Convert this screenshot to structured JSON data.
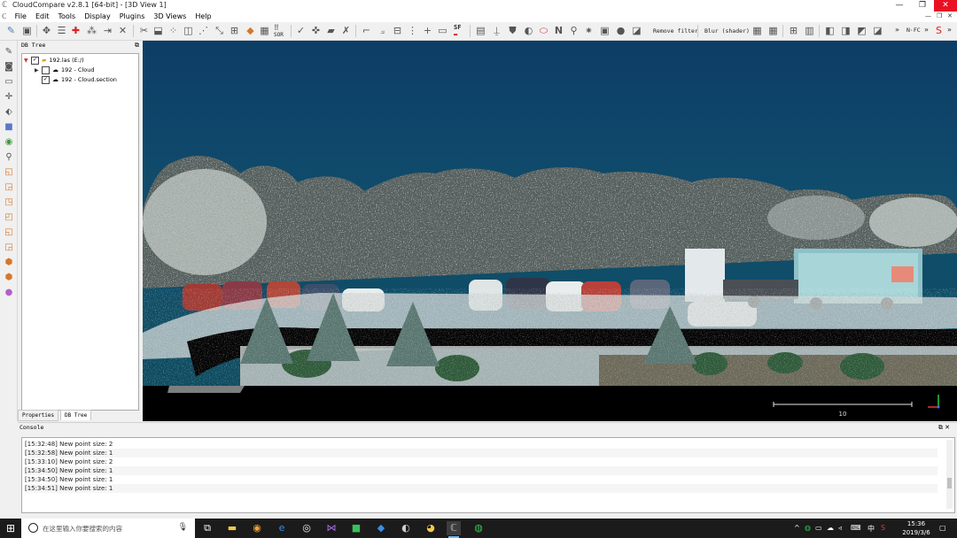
{
  "window": {
    "title": "CloudCompare v2.8.1 [64-bit] - [3D View 1]",
    "app_icon": "cloudcompare-icon",
    "minimize": "—",
    "maximize": "❐",
    "close": "✕"
  },
  "menubar": {
    "items": [
      "File",
      "Edit",
      "Tools",
      "Display",
      "Plugins",
      "3D Views",
      "Help"
    ],
    "mdi_controls": [
      "—",
      "❐",
      "✕"
    ]
  },
  "toolbar": {
    "remove_filter": "Remove filter",
    "blur_shader": "Blur (shader)",
    "sor_label": "SOR",
    "sf_label": "SF",
    "more1": "»",
    "more2": "»",
    "nfc": "N·FC",
    "more3": "»"
  },
  "db_tree": {
    "title": "DB Tree",
    "float_icon": "⧉",
    "items": [
      {
        "label": "192.las (E:/)",
        "checked": true,
        "expanded": true
      },
      {
        "label": "192 - Cloud",
        "checked": false
      },
      {
        "label": "192 - Cloud.section",
        "checked": true
      }
    ],
    "tabs": [
      "Properties",
      "DB Tree"
    ]
  },
  "view3d": {
    "scale_label": "10",
    "colors": {
      "sky_top": "#0d3d66",
      "sky_bottom": "#104e6d",
      "ground": "#000000"
    }
  },
  "console": {
    "title": "Console",
    "controls": "⧉ ✕",
    "lines": [
      "[15:32:48] New point size: 2",
      "[15:32:58] New point size: 1",
      "[15:33:10] New point size: 2",
      "[15:34:50] New point size: 1",
      "[15:34:50] New point size: 1",
      "[15:34:51] New point size: 1"
    ]
  },
  "taskbar": {
    "search_placeholder": "在这里输入你要搜索的内容",
    "time": "15:36",
    "date": "2019/3/6",
    "ime": "中"
  }
}
